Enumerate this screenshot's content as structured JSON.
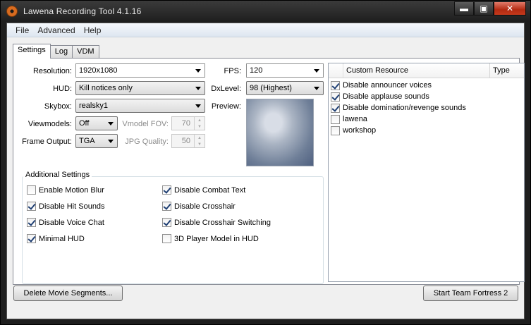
{
  "window": {
    "title": "Lawena Recording Tool 4.1.16",
    "controls": {
      "minimize": "▬",
      "maximize": "▣",
      "close": "✕"
    }
  },
  "menu": [
    "File",
    "Advanced",
    "Help"
  ],
  "tabs": [
    "Settings",
    "Log",
    "VDM"
  ],
  "settings": {
    "resolution": {
      "label": "Resolution:",
      "value": "1920x1080"
    },
    "hud": {
      "label": "HUD:",
      "value": "Kill notices only"
    },
    "skybox": {
      "label": "Skybox:",
      "value": "realsky1"
    },
    "viewmodels": {
      "label": "Viewmodels:",
      "value": "Off"
    },
    "vmodel_fov": {
      "label": "Vmodel FOV:",
      "value": "70"
    },
    "frame_output": {
      "label": "Frame Output:",
      "value": "TGA"
    },
    "jpg_quality": {
      "label": "JPG Quality:",
      "value": "50"
    },
    "fps": {
      "label": "FPS:",
      "value": "120"
    },
    "dxlevel": {
      "label": "DxLevel:",
      "value": "98 (Highest)"
    },
    "preview": {
      "label": "Preview:"
    }
  },
  "additional": {
    "title": "Additional Settings",
    "left": [
      {
        "label": "Enable Motion Blur",
        "checked": false
      },
      {
        "label": "Disable Hit Sounds",
        "checked": true
      },
      {
        "label": "Disable Voice Chat",
        "checked": true
      },
      {
        "label": "Minimal HUD",
        "checked": true
      }
    ],
    "right": [
      {
        "label": "Disable Combat Text",
        "checked": true
      },
      {
        "label": "Disable Crosshair",
        "checked": true
      },
      {
        "label": "Disable Crosshair Switching",
        "checked": true
      },
      {
        "label": "3D Player Model in HUD",
        "checked": false
      }
    ]
  },
  "resources": {
    "columns": [
      "Custom Resource",
      "Type"
    ],
    "rows": [
      {
        "name": "Disable announcer voices",
        "checked": true
      },
      {
        "name": "Disable applause sounds",
        "checked": true
      },
      {
        "name": "Disable domination/revenge sounds",
        "checked": true
      },
      {
        "name": "lawena",
        "checked": false
      },
      {
        "name": "workshop",
        "checked": false
      }
    ]
  },
  "buttons": {
    "delete": "Delete Movie Segments...",
    "start": "Start Team Fortress 2"
  }
}
